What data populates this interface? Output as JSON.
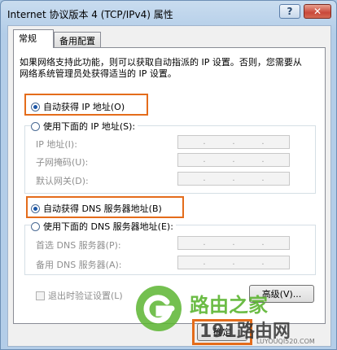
{
  "window": {
    "title": "Internet 协议版本 4 (TCP/IPv4) 属性",
    "help_label": "?",
    "close_label": "✕"
  },
  "tabs": [
    {
      "label": "常规"
    },
    {
      "label": "备用配置"
    }
  ],
  "description": "如果网络支持此功能，则可以获取自动指派的 IP 设置。否则，您需要从网络系统管理员处获得适当的 IP 设置。",
  "ip_section": {
    "auto_label": "自动获得 IP 地址(O)",
    "manual_label": "使用下面的 IP 地址(S):",
    "fields": [
      {
        "label": "IP 地址(I):"
      },
      {
        "label": "子网掩码(U):"
      },
      {
        "label": "默认网关(D):"
      }
    ]
  },
  "dns_section": {
    "auto_label": "自动获得 DNS 服务器地址(B)",
    "manual_label": "使用下面的 DNS 服务器地址(E):",
    "fields": [
      {
        "label": "首选 DNS 服务器(P):"
      },
      {
        "label": "备用 DNS 服务器(A):"
      }
    ]
  },
  "validate_label": "退出时验证设置(L)",
  "advanced_label": "高级(V)...",
  "ok_label": "确定",
  "watermark": {
    "brand": "路由之家",
    "site": "191路由网",
    "url": "LUYOUQI520.COM"
  },
  "colors": {
    "highlight": "#e46c1b",
    "logo_green": "#5cb531"
  }
}
